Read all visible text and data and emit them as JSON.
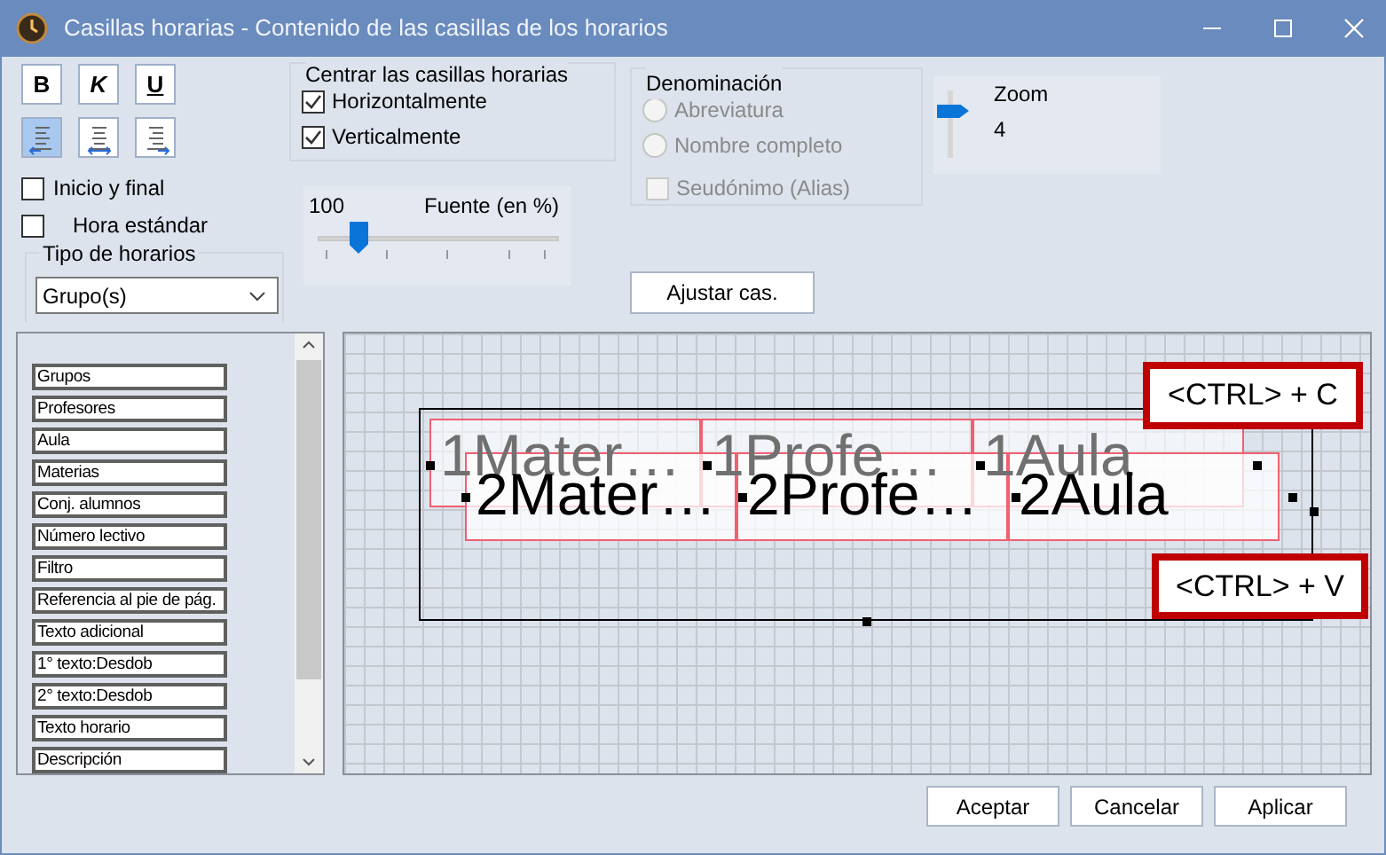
{
  "window": {
    "title": "Casillas horarias - Contenido de las casillas de los horarios"
  },
  "format_buttons": [
    {
      "kind": "bold",
      "label": "B",
      "selected": false
    },
    {
      "kind": "italic",
      "label": "K",
      "selected": false
    },
    {
      "kind": "underline",
      "label": "U",
      "selected": false
    }
  ],
  "alignment_buttons": [
    {
      "kind": "left",
      "selected": true
    },
    {
      "kind": "center",
      "selected": false
    },
    {
      "kind": "right",
      "selected": false
    }
  ],
  "options": [
    {
      "label": "Inicio y final",
      "checked": false
    },
    {
      "label": "Hora estándar",
      "checked": false
    }
  ],
  "schedule_type": {
    "label": "Tipo de horarios",
    "value": "Grupo(s)"
  },
  "centering": {
    "title": "Centrar las casillas horarias",
    "options": [
      {
        "label": "Horizontalmente",
        "checked": true
      },
      {
        "label": "Verticalmente",
        "checked": true
      }
    ]
  },
  "font_size": {
    "value": "100",
    "label": "Fuente (en %)",
    "level": 0.14
  },
  "naming": {
    "title": "Denominación",
    "options": [
      {
        "kind": "radio",
        "label": "Abreviatura",
        "selected": false,
        "disabled": true
      },
      {
        "kind": "radio",
        "label": "Nombre completo",
        "selected": false,
        "disabled": true
      },
      {
        "kind": "checkbox",
        "label": "Seudónimo (Alias)",
        "checked": false,
        "disabled": true
      }
    ]
  },
  "zoom": {
    "label": "Zoom",
    "value": "4",
    "level": 0.75
  },
  "adjust_button": "Ajustar cas.",
  "fields": [
    "Grupos",
    "Profesores",
    "Aula",
    "Materias",
    "Conj. alumnos",
    "Número lectivo",
    "Filtro",
    "Referencia al pie de pág.",
    "Texto adicional",
    "1° texto:Desdob",
    "2° texto:Desdob",
    "Texto horario",
    "Descripción"
  ],
  "canvas": {
    "rows": [
      {
        "cells": [
          "1Mater…",
          "1Profe…",
          "1Aula"
        ]
      },
      {
        "cells": [
          "2Mater…",
          "2Profe…",
          "2Aula"
        ]
      }
    ],
    "hints": [
      "<CTRL> + C",
      "<CTRL> + V"
    ]
  },
  "buttons": [
    "Aceptar",
    "Cancelar",
    "Aplicar"
  ]
}
